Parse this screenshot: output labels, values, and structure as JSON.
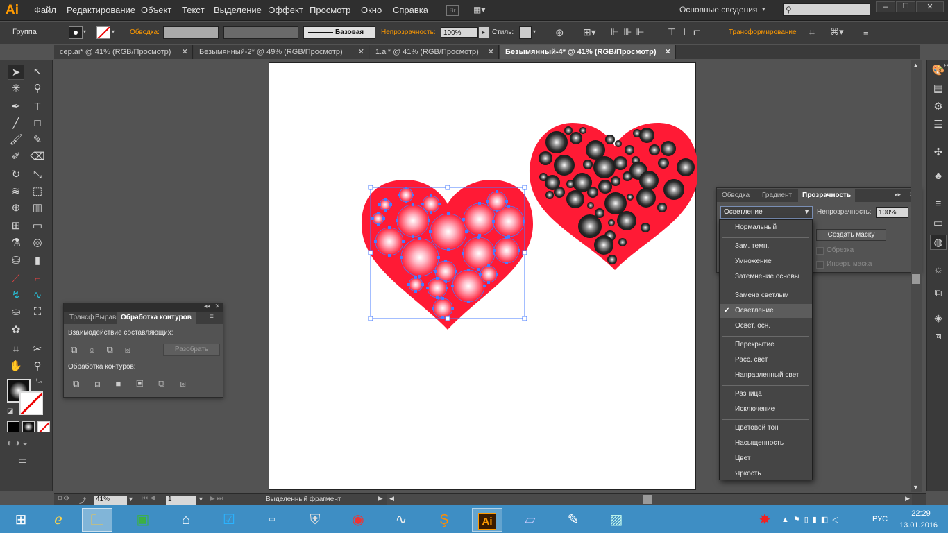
{
  "app": {
    "logo": "Ai",
    "menu": [
      "Файл",
      "Редактирование",
      "Объект",
      "Текст",
      "Выделение",
      "Эффект",
      "Просмотр",
      "Окно",
      "Справка"
    ],
    "bridge_label": "Br",
    "workspace": "Основные сведения",
    "search_placeholder": ""
  },
  "control_bar": {
    "selection_type": "Группа",
    "stroke_label": "Обводка:",
    "stroke_profile": "Базовая",
    "opacity_label": "Непрозрачность:",
    "opacity_value": "100%",
    "style_label": "Стиль:",
    "transform_label": "Трансформирование"
  },
  "doc_tabs": [
    {
      "label": "сер.ai* @ 41% (RGB/Просмотр)"
    },
    {
      "label": "Безымянный-2* @ 49% (RGB/Просмотр)"
    },
    {
      "label": "1.ai* @ 41% (RGB/Просмотр)"
    },
    {
      "label": "Безымянный-4* @ 41% (RGB/Просмотр)"
    }
  ],
  "pathfinder_panel": {
    "tabs": [
      "Трансф",
      "Выравн",
      "Обработка контуров"
    ],
    "shape_modes_label": "Взаимодействие составляющих:",
    "expand_label": "Разобрать",
    "pathfinders_label": "Обработка контуров:"
  },
  "transparency_panel": {
    "tabs": [
      "Обводка",
      "Градиент",
      "Прозрачность"
    ],
    "blend_mode": "Осветление",
    "opacity_label": "Непрозрачность:",
    "opacity_value": "100%",
    "make_mask_label": "Создать маску",
    "clip_label": "Обрезка",
    "invert_mask_label": "Инверт. маска"
  },
  "blend_modes": {
    "items": [
      "Нормальный",
      "Зам. темн.",
      "Умножение",
      "Затемнение основы",
      "Замена светлым",
      "Осветление",
      "Освет. осн.",
      "Перекрытие",
      "Расс. свет",
      "Направленный свет",
      "Разница",
      "Исключение",
      "Цветовой тон",
      "Насыщенность",
      "Цвет",
      "Яркость"
    ],
    "selected": "Осветление"
  },
  "status_bar": {
    "zoom": "41%",
    "page": "1",
    "status_text": "Выделенный фрагмент"
  },
  "taskbar": {
    "language": "РУС",
    "time": "22:29",
    "date": "13.01.2016"
  },
  "colors": {
    "heart_red": "#ff1a35",
    "selection_blue": "#4a7cff",
    "taskbar_blue": "#3e8ec4",
    "ai_orange": "#ff9a00"
  }
}
